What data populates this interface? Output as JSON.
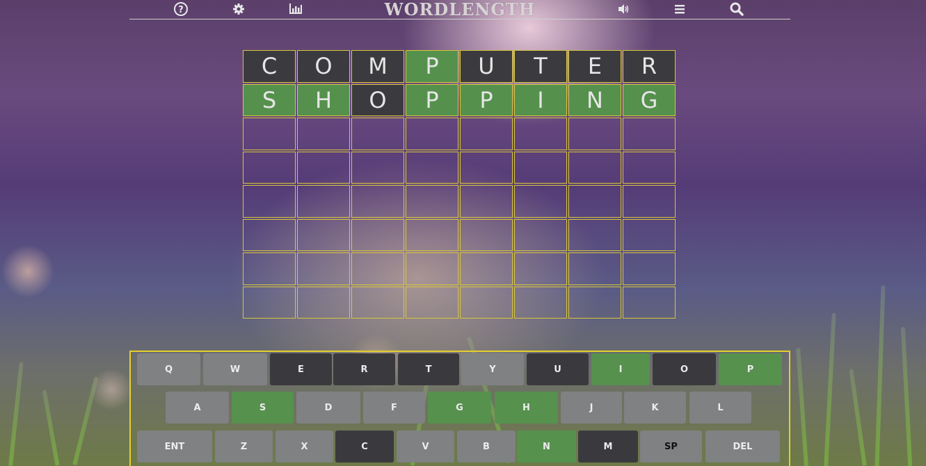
{
  "header": {
    "title": "WORDLENGTH",
    "icons": [
      "help-icon",
      "settings-icon",
      "stats-icon",
      "sound-icon",
      "menu-icon",
      "search-icon"
    ]
  },
  "board": {
    "rows": [
      [
        {
          "letter": "C",
          "state": "absent"
        },
        {
          "letter": "O",
          "state": "absent"
        },
        {
          "letter": "M",
          "state": "absent"
        },
        {
          "letter": "P",
          "state": "correct"
        },
        {
          "letter": "U",
          "state": "absent"
        },
        {
          "letter": "T",
          "state": "absent"
        },
        {
          "letter": "E",
          "state": "absent"
        },
        {
          "letter": "R",
          "state": "absent"
        }
      ],
      [
        {
          "letter": "S",
          "state": "correct"
        },
        {
          "letter": "H",
          "state": "correct"
        },
        {
          "letter": "O",
          "state": "absent"
        },
        {
          "letter": "P",
          "state": "correct"
        },
        {
          "letter": "P",
          "state": "correct"
        },
        {
          "letter": "I",
          "state": "correct"
        },
        {
          "letter": "N",
          "state": "correct"
        },
        {
          "letter": "G",
          "state": "correct"
        }
      ],
      [
        {
          "letter": "",
          "state": "empty"
        },
        {
          "letter": "",
          "state": "empty"
        },
        {
          "letter": "",
          "state": "empty"
        },
        {
          "letter": "",
          "state": "empty"
        },
        {
          "letter": "",
          "state": "empty"
        },
        {
          "letter": "",
          "state": "empty"
        },
        {
          "letter": "",
          "state": "empty"
        },
        {
          "letter": "",
          "state": "empty"
        }
      ],
      [
        {
          "letter": "",
          "state": "empty"
        },
        {
          "letter": "",
          "state": "empty"
        },
        {
          "letter": "",
          "state": "empty"
        },
        {
          "letter": "",
          "state": "empty"
        },
        {
          "letter": "",
          "state": "empty"
        },
        {
          "letter": "",
          "state": "empty"
        },
        {
          "letter": "",
          "state": "empty"
        },
        {
          "letter": "",
          "state": "empty"
        }
      ],
      [
        {
          "letter": "",
          "state": "empty"
        },
        {
          "letter": "",
          "state": "empty"
        },
        {
          "letter": "",
          "state": "empty"
        },
        {
          "letter": "",
          "state": "empty"
        },
        {
          "letter": "",
          "state": "empty"
        },
        {
          "letter": "",
          "state": "empty"
        },
        {
          "letter": "",
          "state": "empty"
        },
        {
          "letter": "",
          "state": "empty"
        }
      ],
      [
        {
          "letter": "",
          "state": "empty"
        },
        {
          "letter": "",
          "state": "empty"
        },
        {
          "letter": "",
          "state": "empty"
        },
        {
          "letter": "",
          "state": "empty"
        },
        {
          "letter": "",
          "state": "empty"
        },
        {
          "letter": "",
          "state": "empty"
        },
        {
          "letter": "",
          "state": "empty"
        },
        {
          "letter": "",
          "state": "empty"
        }
      ],
      [
        {
          "letter": "",
          "state": "empty"
        },
        {
          "letter": "",
          "state": "empty"
        },
        {
          "letter": "",
          "state": "empty"
        },
        {
          "letter": "",
          "state": "empty"
        },
        {
          "letter": "",
          "state": "empty"
        },
        {
          "letter": "",
          "state": "empty"
        },
        {
          "letter": "",
          "state": "empty"
        },
        {
          "letter": "",
          "state": "empty"
        }
      ],
      [
        {
          "letter": "",
          "state": "empty"
        },
        {
          "letter": "",
          "state": "empty"
        },
        {
          "letter": "",
          "state": "empty"
        },
        {
          "letter": "",
          "state": "empty"
        },
        {
          "letter": "",
          "state": "empty"
        },
        {
          "letter": "",
          "state": "empty"
        },
        {
          "letter": "",
          "state": "empty"
        },
        {
          "letter": "",
          "state": "empty"
        }
      ]
    ]
  },
  "keyboard": {
    "rows": [
      [
        {
          "label": "Q",
          "state": "unused"
        },
        {
          "label": "W",
          "state": "unused"
        },
        {
          "label": "E",
          "state": "absent"
        },
        {
          "label": "R",
          "state": "absent"
        },
        {
          "label": "T",
          "state": "absent"
        },
        {
          "label": "Y",
          "state": "unused"
        },
        {
          "label": "U",
          "state": "absent"
        },
        {
          "label": "I",
          "state": "correct"
        },
        {
          "label": "O",
          "state": "absent"
        },
        {
          "label": "P",
          "state": "correct"
        }
      ],
      [
        {
          "label": "A",
          "state": "unused"
        },
        {
          "label": "S",
          "state": "correct"
        },
        {
          "label": "D",
          "state": "unused"
        },
        {
          "label": "F",
          "state": "unused"
        },
        {
          "label": "G",
          "state": "correct"
        },
        {
          "label": "H",
          "state": "correct"
        },
        {
          "label": "J",
          "state": "unused"
        },
        {
          "label": "K",
          "state": "unused"
        },
        {
          "label": "L",
          "state": "unused"
        }
      ],
      [
        {
          "label": "ENT",
          "state": "unused"
        },
        {
          "label": "Z",
          "state": "unused"
        },
        {
          "label": "X",
          "state": "unused"
        },
        {
          "label": "C",
          "state": "absent"
        },
        {
          "label": "V",
          "state": "unused"
        },
        {
          "label": "B",
          "state": "unused"
        },
        {
          "label": "N",
          "state": "correct"
        },
        {
          "label": "M",
          "state": "absent"
        },
        {
          "label": "SP",
          "state": "unused-dark-label"
        },
        {
          "label": "DEL",
          "state": "unused"
        }
      ]
    ]
  },
  "colors": {
    "correct": "#55914d",
    "absent": "#3b3b3f",
    "unused": "#7f8182",
    "border": "#e5cf2c"
  }
}
